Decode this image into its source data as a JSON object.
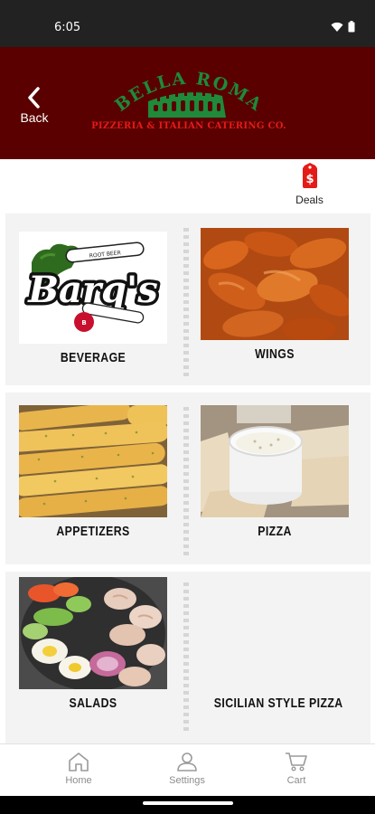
{
  "status_bar": {
    "time": "6:05"
  },
  "header": {
    "back_label": "Back",
    "logo_name": "BELLA ROMA",
    "logo_tagline": "PIZZERIA & ITALIAN CATERING CO.",
    "background_color": "#5a0000",
    "logo_green": "#1e8a3a",
    "logo_red": "#e41b17"
  },
  "deals": {
    "label": "Deals",
    "icon": "dollar-tag-icon",
    "color": "#e41b17"
  },
  "categories": [
    {
      "label": "BEVERAGE",
      "image": "barqs-logo-image"
    },
    {
      "label": "WINGS",
      "image": "wings-photo"
    },
    {
      "label": "APPETIZERS",
      "image": "breadsticks-photo"
    },
    {
      "label": "PIZZA",
      "image": "pita-dip-photo"
    },
    {
      "label": "SALADS",
      "image": "salad-photo"
    },
    {
      "label": "SICILIAN STYLE PIZZA",
      "image": ""
    }
  ],
  "barqs_logo_text": "Barq's",
  "bottom_nav": [
    {
      "label": "Home",
      "icon": "home-icon"
    },
    {
      "label": "Settings",
      "icon": "person-icon"
    },
    {
      "label": "Cart",
      "icon": "cart-icon"
    }
  ]
}
